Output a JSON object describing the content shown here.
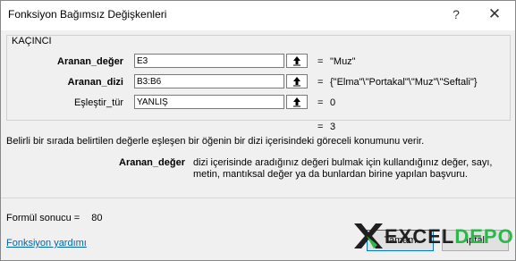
{
  "window": {
    "title": "Fonksiyon Bağımsız Değişkenleri",
    "help_glyph": "?",
    "close_glyph": "✕"
  },
  "group": {
    "title": "KAÇINCI"
  },
  "args": [
    {
      "label": "Aranan_değer",
      "value": "E3",
      "result": "\"Muz\""
    },
    {
      "label": "Aranan_dizi",
      "value": "B3:B6",
      "result": "{\"Elma\"\\\"Portakal\"\\\"Muz\"\\\"Seftali\"}"
    },
    {
      "label": "Eşleştir_tür",
      "value": "YANLIŞ",
      "result": "0"
    }
  ],
  "equals": "=",
  "overall_result": "3",
  "description": "Belirli bir sırada belirtilen değerle eşleşen bir öğenin bir dizi içerisindeki göreceli konumunu verir.",
  "help": {
    "name": "Aranan_değer",
    "text": "dizi içerisinde aradığınız değeri bulmak için kullandığınız değer, sayı, metin, mantıksal değer ya da bunlardan birine yapılan başvuru."
  },
  "formula_result": {
    "label": "Formül sonucu =",
    "value": "80"
  },
  "help_link": "Fonksiyon yardımı",
  "buttons": {
    "ok": "Tamam",
    "cancel": "İptal"
  },
  "watermark": {
    "x": "X",
    "excel": "EXCEL",
    "depo": "DEPO"
  },
  "colors": {
    "link": "#0063b1",
    "watermark_green": "#2bb84a",
    "ok_border": "#0078d7"
  }
}
